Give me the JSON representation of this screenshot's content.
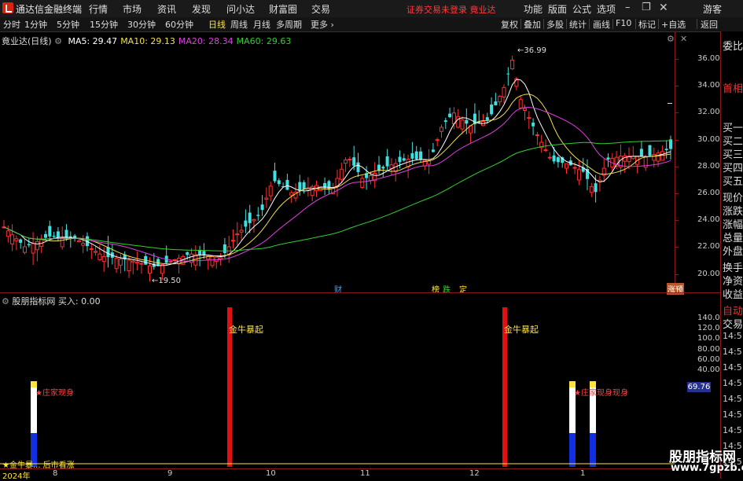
{
  "titlebar": {
    "app": "通达信金融终端",
    "menus": [
      "行情",
      "市场",
      "资讯",
      "发现",
      "问小达",
      "财富圈",
      "交易"
    ],
    "warning": "证券交易未登录  竟业达",
    "right_menus": [
      "功能",
      "版面",
      "公式",
      "选项"
    ],
    "guest": "游客",
    "controls": [
      "minimize",
      "restore",
      "close"
    ]
  },
  "toolbar": {
    "periods": [
      "分时",
      "1分钟",
      "5分钟",
      "15分钟",
      "30分钟",
      "60分钟",
      "日线",
      "周线",
      "月线",
      "多周期",
      "更多 ›"
    ],
    "active": "日线",
    "right": [
      "复权",
      "叠加",
      "多股",
      "统计",
      "画线",
      "F10",
      "标记",
      "+自选",
      "返回"
    ]
  },
  "chart": {
    "stock_label": "竟业达(日线)",
    "ma": [
      {
        "name": "MA5",
        "value": "29.47",
        "color": "#ffffff"
      },
      {
        "name": "MA10",
        "value": "29.13",
        "color": "#f0e050"
      },
      {
        "name": "MA20",
        "value": "28.34",
        "color": "#e040e0"
      },
      {
        "name": "MA60",
        "value": "29.63",
        "color": "#30d030"
      }
    ],
    "high_label": "36.99",
    "low_label": "19.50",
    "y_ticks": [
      "36.00",
      "34.00",
      "32.00",
      "30.00",
      "28.00",
      "26.00",
      "24.00",
      "22.00",
      "20.00"
    ],
    "event_marks": [
      {
        "text": "财",
        "color": "#40a0ff"
      },
      {
        "text": "榜",
        "color": "#ffe23b"
      },
      {
        "text": "跌",
        "color": "#30d030"
      },
      {
        "text": "定",
        "color": "#ffe23b"
      },
      {
        "text": "涨预",
        "color": "#ffffff"
      }
    ]
  },
  "indicator": {
    "head": "股朋指标网  买入: 0.00",
    "y_ticks": [
      "140.00",
      "120.00",
      "100.00",
      "80.00",
      "60.00",
      "40.00"
    ],
    "current": "69.76",
    "labels": [
      "金牛暴起",
      "金牛暴起",
      "★庄家现身",
      "★庄家现身现身",
      "★金牛暴... 后市看涨"
    ]
  },
  "xaxis": {
    "labels": [
      "2024年",
      "8",
      "9",
      "10",
      "11",
      "12",
      "1"
    ]
  },
  "right_panel": {
    "items": [
      "委比",
      "首相",
      "买一",
      "买二",
      "买三",
      "买四",
      "买五",
      "现价",
      "涨跌",
      "涨幅",
      "总量",
      "外盘",
      "换手",
      "净资",
      "收益",
      "自动",
      "交易"
    ],
    "times": [
      "14:5",
      "14:5",
      "14:5",
      "14:5",
      "14:5",
      "14:5",
      "14:5",
      "14:5",
      "14:5"
    ]
  },
  "watermark": {
    "line1": "股朋指标网",
    "line2": "www.7gpzb.com"
  }
}
